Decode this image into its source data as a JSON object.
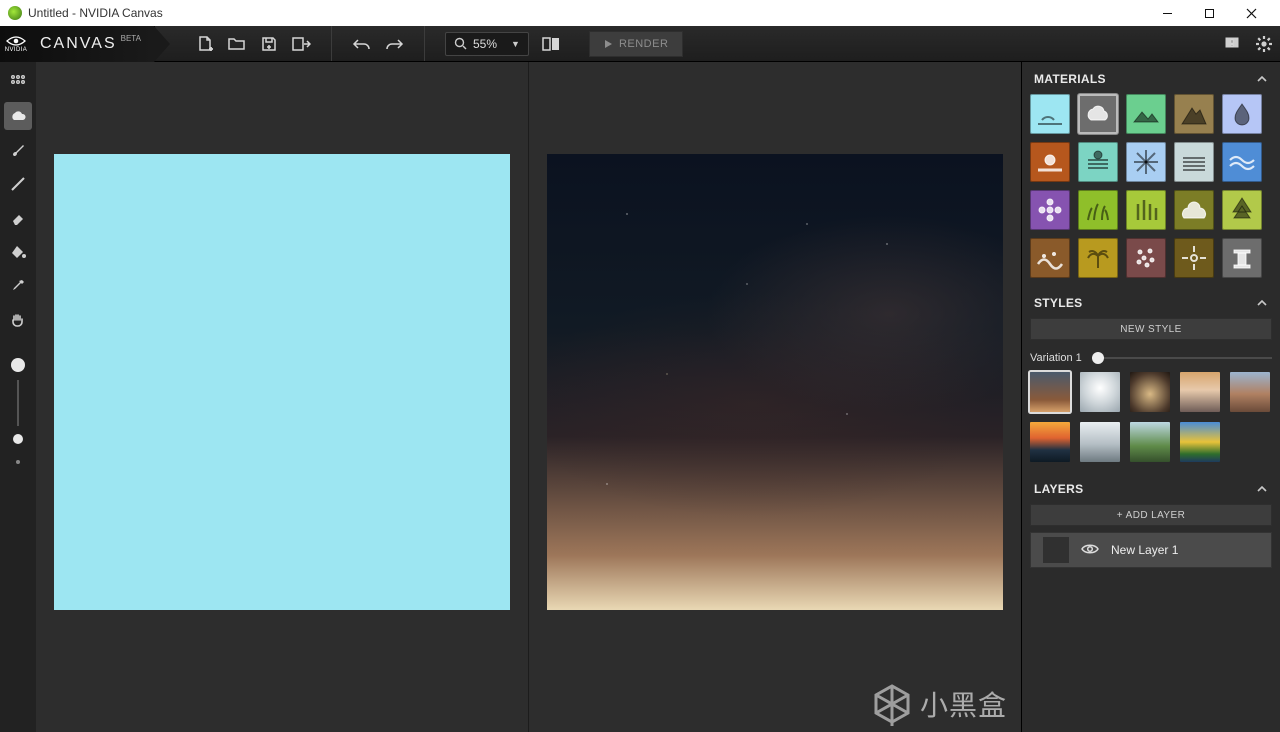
{
  "window": {
    "title": "Untitled - NVIDIA Canvas"
  },
  "brand": {
    "name": "CANVAS",
    "badge": "BETA",
    "vendor": "NVIDIA"
  },
  "toolbar": {
    "zoom": "55%",
    "render_label": "RENDER"
  },
  "left_tools": [
    {
      "name": "grid-icon",
      "active": false
    },
    {
      "name": "cloud-material-tool",
      "active": true
    },
    {
      "name": "brush-tool",
      "active": false
    },
    {
      "name": "line-tool",
      "active": false
    },
    {
      "name": "eraser-tool",
      "active": false
    },
    {
      "name": "fill-tool",
      "active": false
    },
    {
      "name": "eyedropper-tool",
      "active": false
    },
    {
      "name": "pan-tool",
      "active": false
    }
  ],
  "panels": {
    "materials": {
      "title": "MATERIALS",
      "items": [
        {
          "name": "sky",
          "color": "#9de6f2",
          "icon": "horizon",
          "dark": true
        },
        {
          "name": "cloud",
          "color": "#6d6d6d",
          "icon": "cloud",
          "dark": false,
          "selected": true
        },
        {
          "name": "hill",
          "color": "#6bcf8f",
          "icon": "hill",
          "dark": true
        },
        {
          "name": "mountain",
          "color": "#97804f",
          "icon": "mountain",
          "dark": true
        },
        {
          "name": "water-drop",
          "color": "#b6c6f6",
          "icon": "drop",
          "dark": true
        },
        {
          "name": "lava",
          "color": "#b6571d",
          "icon": "sun",
          "dark": false
        },
        {
          "name": "haze",
          "color": "#7cd4c3",
          "icon": "haze",
          "dark": true
        },
        {
          "name": "snow",
          "color": "#a9cef2",
          "icon": "snow",
          "dark": true
        },
        {
          "name": "fog",
          "color": "#c9d9da",
          "icon": "fog",
          "dark": true
        },
        {
          "name": "sea",
          "color": "#4f8dd6",
          "icon": "waves",
          "dark": false
        },
        {
          "name": "flower",
          "color": "#8653b0",
          "icon": "flower",
          "dark": false
        },
        {
          "name": "grass",
          "color": "#8fbf2a",
          "icon": "grass",
          "dark": true
        },
        {
          "name": "reeds",
          "color": "#a7c93a",
          "icon": "reeds",
          "dark": true
        },
        {
          "name": "bush",
          "color": "#7c7d26",
          "icon": "bush",
          "dark": false
        },
        {
          "name": "tree",
          "color": "#b2c94a",
          "icon": "tree",
          "dark": true
        },
        {
          "name": "dirt",
          "color": "#8a5a2a",
          "icon": "dirt",
          "dark": false
        },
        {
          "name": "palm",
          "color": "#b89a1f",
          "icon": "palm",
          "dark": true
        },
        {
          "name": "gravel",
          "color": "#7a4a4a",
          "icon": "dots",
          "dark": false
        },
        {
          "name": "sparkle",
          "color": "#6e5a1c",
          "icon": "sparkle",
          "dark": false
        },
        {
          "name": "ruin",
          "color": "#6d6d6d",
          "icon": "pillar",
          "dark": false
        }
      ]
    },
    "styles": {
      "title": "STYLES",
      "new_style": "NEW STYLE",
      "variation_label": "Variation 1",
      "thumbs": [
        {
          "name": "style-1",
          "bg": "linear-gradient(180deg,#4b5a6c 0%,#8a5a3a 70%,#d6a06a 100%)",
          "selected": true
        },
        {
          "name": "style-2",
          "bg": "radial-gradient(circle at 50% 40%,#fff,#cfd6da 50%,#9aa6ae 100%)"
        },
        {
          "name": "style-3",
          "bg": "radial-gradient(circle at 50% 55%,#d9b985,#4d3a2c 70%,#1f1712 100%)"
        },
        {
          "name": "style-4",
          "bg": "linear-gradient(180deg,#d7a56d 0%,#e7c9ab 45%,#6f5d57 100%)"
        },
        {
          "name": "style-5",
          "bg": "linear-gradient(180deg,#9bb4cf 0%,#b08062 55%,#6a4a39 100%)"
        },
        {
          "name": "style-6",
          "bg": "linear-gradient(180deg,#f5a93b 0%,#e06330 40%,#203142 70%,#0e1a24 100%)"
        },
        {
          "name": "style-7",
          "bg": "linear-gradient(180deg,#e9eef1 0%,#b5bfc5 55%,#6e7a81 100%)"
        },
        {
          "name": "style-8",
          "bg": "linear-gradient(180deg,#bdd8e2 0%,#5f8b49 60%,#35502c 100%)"
        },
        {
          "name": "style-9",
          "bg": "linear-gradient(180deg,#4a8dd6 0%,#e8c23a 50%,#2f6e2c 80%,#1e3a5d 100%)"
        }
      ]
    },
    "layers": {
      "title": "LAYERS",
      "add_layer": "+ ADD LAYER",
      "items": [
        {
          "name": "New Layer 1",
          "visible": true
        }
      ]
    }
  },
  "watermark": "小黑盒"
}
